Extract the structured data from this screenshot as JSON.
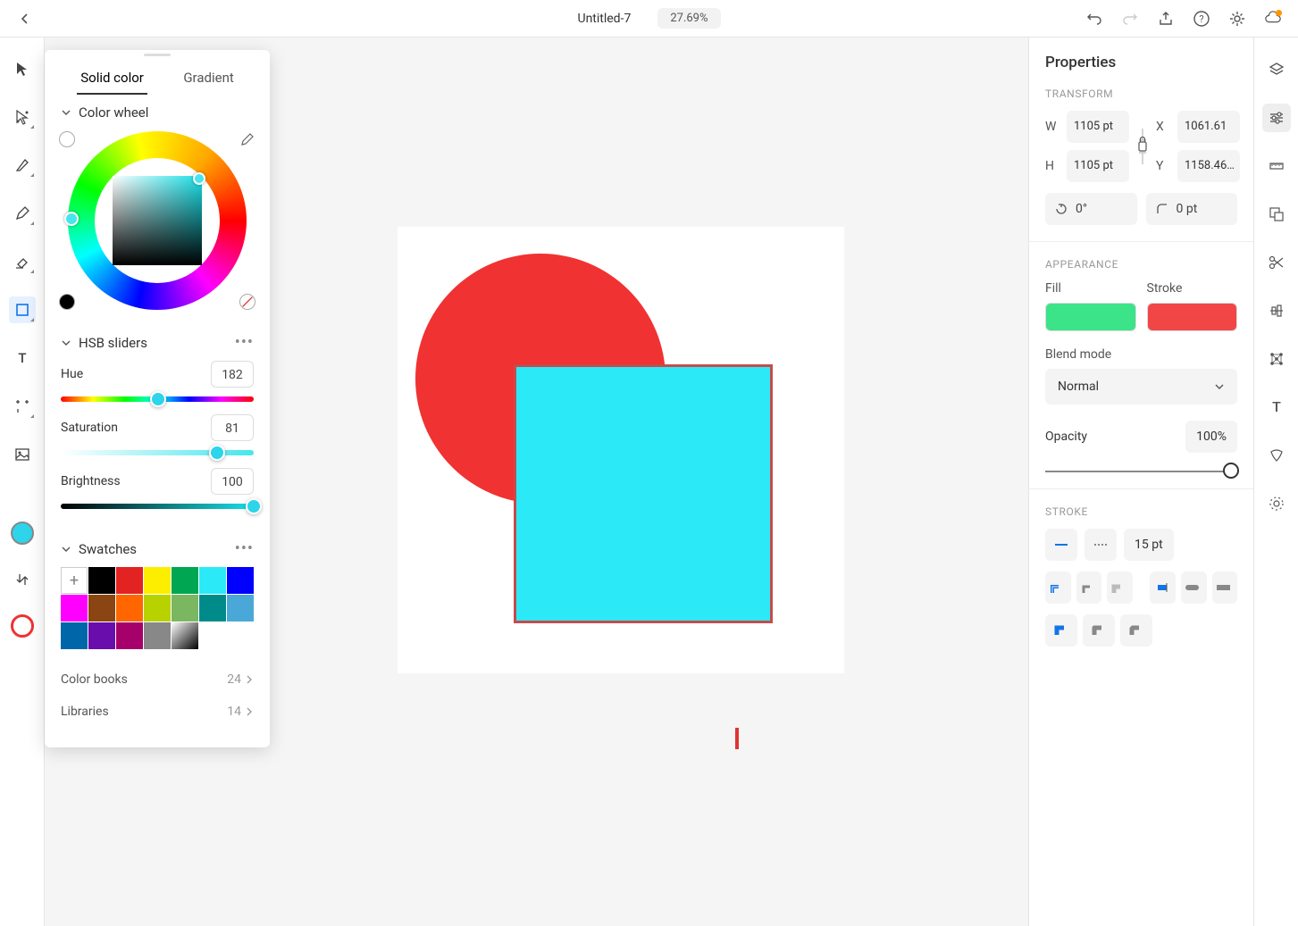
{
  "header": {
    "document_title": "Untitled-7",
    "zoom": "27.69%"
  },
  "color_panel": {
    "tabs": {
      "solid": "Solid color",
      "gradient": "Gradient"
    },
    "color_wheel_label": "Color wheel",
    "hsb_sliders_label": "HSB sliders",
    "hue_label": "Hue",
    "hue_value": "182",
    "saturation_label": "Saturation",
    "saturation_value": "81",
    "brightness_label": "Brightness",
    "brightness_value": "100",
    "swatches_label": "Swatches",
    "swatch_colors": [
      "#000000",
      "#e32322",
      "#fdee00",
      "#00a651",
      "#2ce9f8",
      "#0000fe",
      "#ff00ff",
      "#8b4513",
      "#ff6600",
      "#b8d200",
      "#7bb661",
      "#008b8b",
      "#4aa8d8",
      "#0066aa",
      "#6a0dad",
      "#a6006a",
      "#888888"
    ],
    "color_books_label": "Color books",
    "color_books_count": "24",
    "libraries_label": "Libraries",
    "libraries_count": "14"
  },
  "properties": {
    "title": "Properties",
    "transform_label": "TRANSFORM",
    "W_label": "W",
    "W_value": "1105 pt",
    "H_label": "H",
    "H_value": "1105 pt",
    "X_label": "X",
    "X_value": "1061.61 pt",
    "Y_label": "Y",
    "Y_value": "1158.46…",
    "rotation_value": "0°",
    "corner_value": "0 pt",
    "appearance_label": "APPEARANCE",
    "fill_label": "Fill",
    "stroke_label": "Stroke",
    "fill_color": "#3be389",
    "stroke_color": "#f24646",
    "blend_label": "Blend mode",
    "blend_value": "Normal",
    "opacity_label": "Opacity",
    "opacity_value": "100%",
    "stroke_section_label": "STROKE",
    "stroke_width": "15 pt"
  },
  "canvas": {
    "circle_color": "#f03232",
    "square_fill": "#2ce9f8",
    "square_stroke": "#c74b4b"
  },
  "tools": {
    "current_fill": "#2dd4ea",
    "current_stroke": "#f03232"
  }
}
